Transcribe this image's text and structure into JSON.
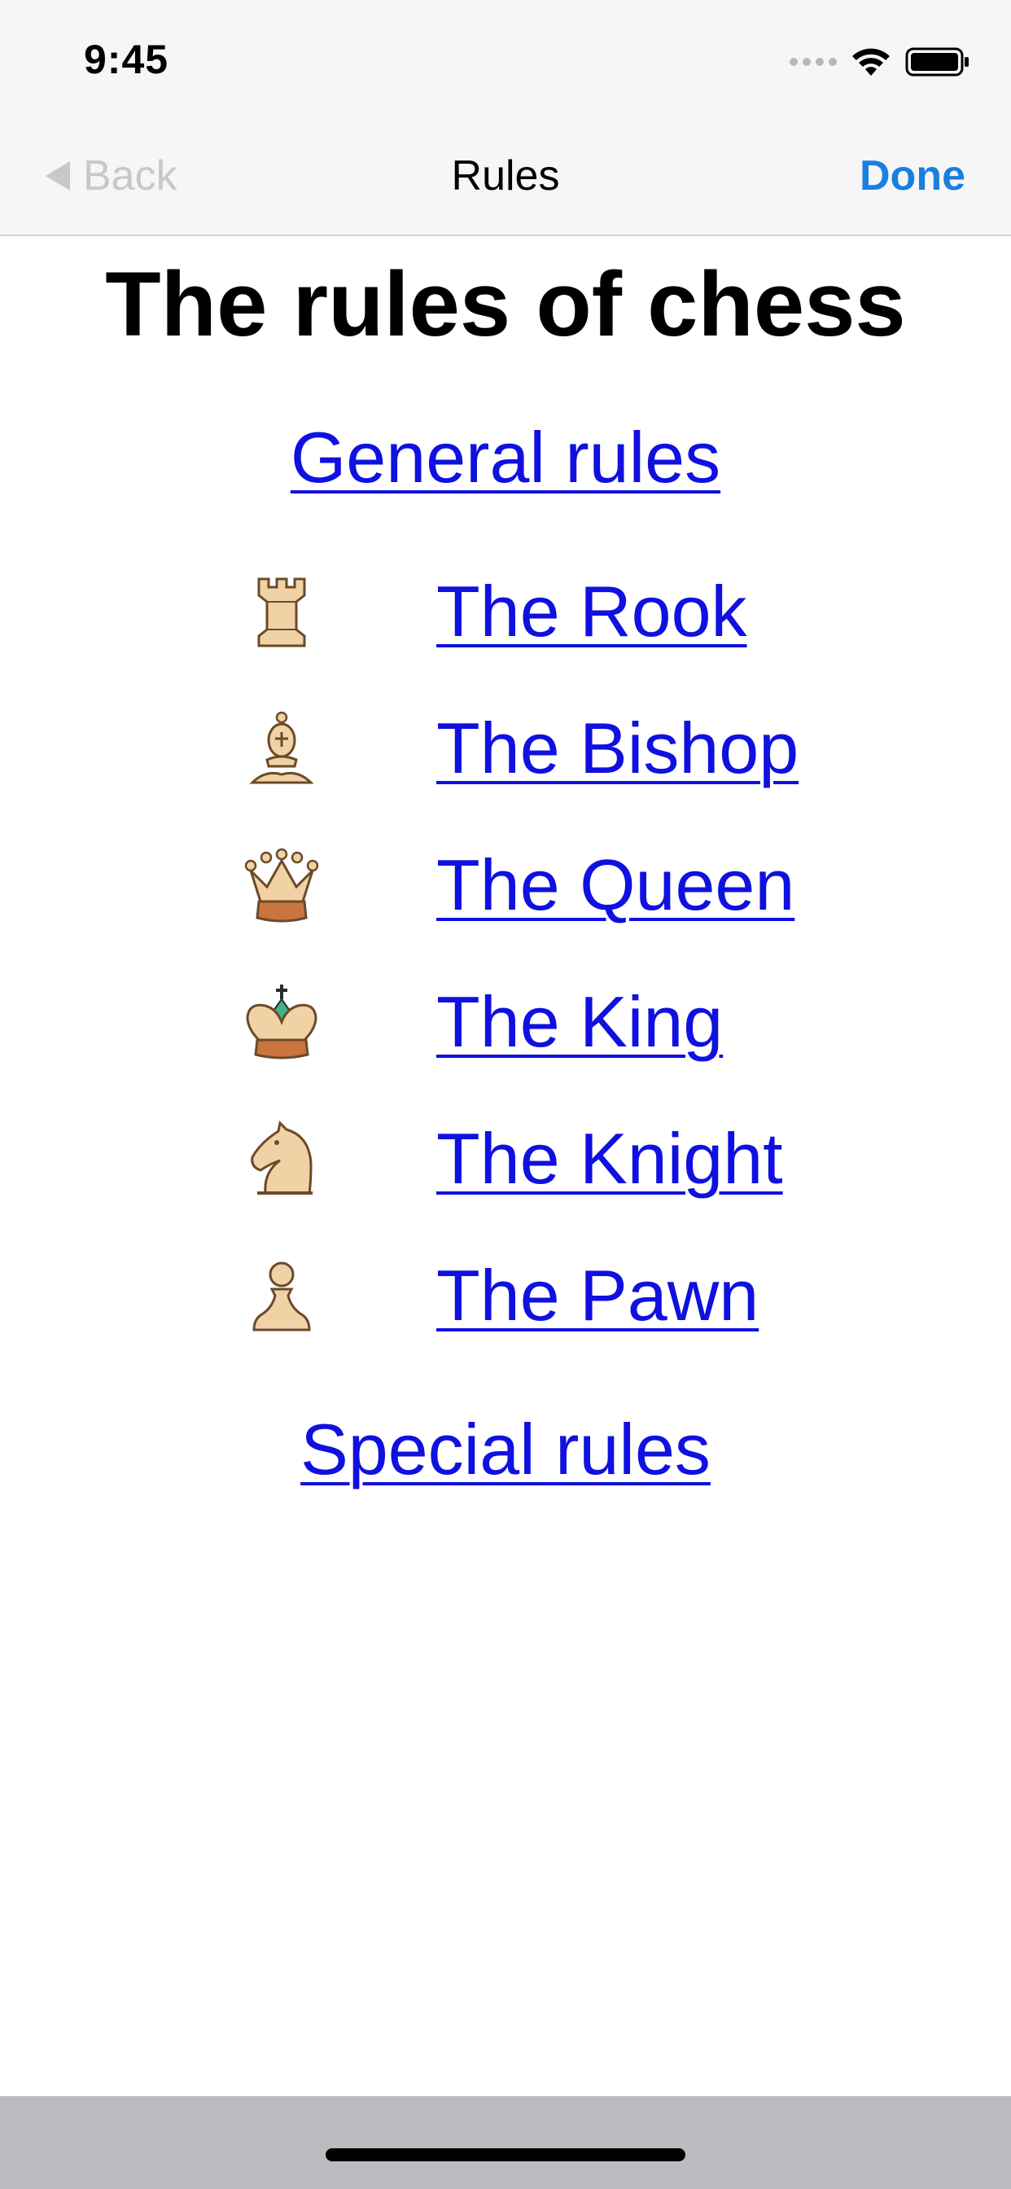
{
  "status_bar": {
    "time": "9:45"
  },
  "nav": {
    "back_label": "Back",
    "title": "Rules",
    "done_label": "Done"
  },
  "page": {
    "title": "The rules of chess",
    "general_link": "General rules",
    "special_link": "Special rules",
    "pieces": [
      {
        "icon": "rook-icon",
        "label": "The Rook"
      },
      {
        "icon": "bishop-icon",
        "label": "The Bishop"
      },
      {
        "icon": "queen-icon",
        "label": "The Queen"
      },
      {
        "icon": "king-icon",
        "label": "The King"
      },
      {
        "icon": "knight-icon",
        "label": "The Knight"
      },
      {
        "icon": "pawn-icon",
        "label": "The Pawn"
      }
    ]
  },
  "colors": {
    "link": "#1010e0",
    "accent": "#1a7fe0",
    "back_disabled": "#c8c8c8"
  }
}
